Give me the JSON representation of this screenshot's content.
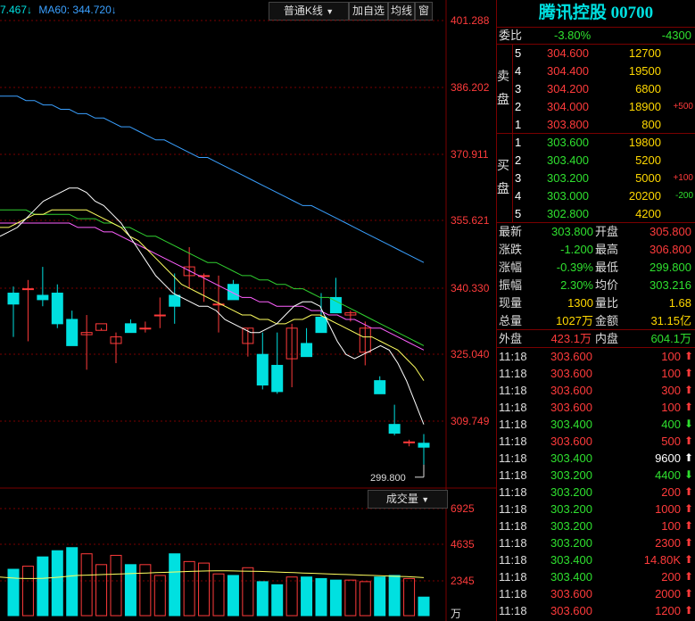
{
  "ma_header": {
    "ma_prev": "7.467↓",
    "ma60": "MA60: 344.720↓"
  },
  "toolbar": {
    "kline_type": "普通K线",
    "add_watch": "加自选",
    "avg_line": "均线",
    "window": "窗"
  },
  "price_axis": {
    "labels": [
      "401.288",
      "386.202",
      "370.911",
      "355.621",
      "340.330",
      "325.040",
      "309.749"
    ],
    "low_label": "299.800"
  },
  "volume_panel": {
    "dropdown": "成交量",
    "labels": [
      "6925",
      "4635",
      "2345"
    ],
    "unit": "万"
  },
  "colors": {
    "up": "#ff3b3b",
    "down": "#00e0e0",
    "grid": "#7a0000",
    "ma5": "#ffffff",
    "ma10": "#ffff60",
    "ma20": "#ff60ff",
    "ma30": "#30d030",
    "ma60": "#3aa0ff"
  },
  "chart_data": {
    "type": "candlestick",
    "ylim": [
      299.8,
      401.288
    ],
    "candles": [
      {
        "o": 352.5,
        "h": 364.0,
        "l": 343.5,
        "c": 352.0
      },
      {
        "o": 357.0,
        "h": 360.0,
        "l": 340.0,
        "c": 359.0
      },
      {
        "o": 358.5,
        "h": 360.5,
        "l": 357.0,
        "c": 359.0
      },
      {
        "o": 357.0,
        "h": 361.0,
        "l": 350.5,
        "c": 360.0
      },
      {
        "o": 359.0,
        "h": 365.0,
        "l": 355.5,
        "c": 364.0
      },
      {
        "o": 363.0,
        "h": 364.0,
        "l": 361.5,
        "c": 362.0
      },
      {
        "o": 363.5,
        "h": 368.0,
        "l": 360.0,
        "c": 363.0
      },
      {
        "o": 366.0,
        "h": 368.0,
        "l": 358.0,
        "c": 366.0
      },
      {
        "o": 365.0,
        "h": 368.0,
        "l": 361.0,
        "c": 364.5
      },
      {
        "o": 361.0,
        "h": 364.0,
        "l": 356.0,
        "c": 362.0
      },
      {
        "o": 355.5,
        "h": 360.0,
        "l": 354.5,
        "c": 355.5
      },
      {
        "o": 357.0,
        "h": 360.5,
        "l": 354.5,
        "c": 354.5
      },
      {
        "o": 363.5,
        "h": 366.0,
        "l": 360.5,
        "c": 360.0
      },
      {
        "o": 360.0,
        "h": 361.5,
        "l": 358.0,
        "c": 356.0
      },
      {
        "o": 357.0,
        "h": 360.0,
        "l": 350.0,
        "c": 352.0
      },
      {
        "o": 350.5,
        "h": 351.0,
        "l": 348.0,
        "c": 341.0
      },
      {
        "o": 346.5,
        "h": 352.0,
        "l": 340.0,
        "c": 348.0
      },
      {
        "o": 337.5,
        "h": 344.0,
        "l": 335.0,
        "c": 340.0
      },
      {
        "o": 341.0,
        "h": 347.0,
        "l": 333.0,
        "c": 338.0
      },
      {
        "o": 345.0,
        "h": 350.0,
        "l": 332.0,
        "c": 345.0
      },
      {
        "o": 335.0,
        "h": 337.0,
        "l": 331.0,
        "c": 336.0
      },
      {
        "o": 339.0,
        "h": 340.5,
        "l": 329.0,
        "c": 336.5
      },
      {
        "o": 340.0,
        "h": 342.0,
        "l": 328.0,
        "c": 340.0
      },
      {
        "o": 338.5,
        "h": 345.0,
        "l": 336.0,
        "c": 337.5
      },
      {
        "o": 339.0,
        "h": 341.0,
        "l": 331.0,
        "c": 332.0
      },
      {
        "o": 333.0,
        "h": 335.0,
        "l": 331.0,
        "c": 327.0
      },
      {
        "o": 329.5,
        "h": 334.0,
        "l": 321.5,
        "c": 330.0
      },
      {
        "o": 330.5,
        "h": 331.0,
        "l": 330.5,
        "c": 332.0
      },
      {
        "o": 327.5,
        "h": 330.0,
        "l": 323.0,
        "c": 329.0
      },
      {
        "o": 332.0,
        "h": 333.0,
        "l": 330.0,
        "c": 330.0
      },
      {
        "o": 331.0,
        "h": 332.5,
        "l": 330.0,
        "c": 331.0
      },
      {
        "o": 334.0,
        "h": 338.0,
        "l": 331.0,
        "c": 334.0
      },
      {
        "o": 338.5,
        "h": 343.5,
        "l": 332.0,
        "c": 336.0
      },
      {
        "o": 343.0,
        "h": 349.5,
        "l": 340.0,
        "c": 345.0
      },
      {
        "o": 343.0,
        "h": 343.5,
        "l": 337.0,
        "c": 343.0
      },
      {
        "o": 336.5,
        "h": 343.0,
        "l": 330.0,
        "c": 336.5
      },
      {
        "o": 341.0,
        "h": 342.0,
        "l": 338.5,
        "c": 337.5
      },
      {
        "o": 327.5,
        "h": 331.0,
        "l": 324.5,
        "c": 331.0
      },
      {
        "o": 325.0,
        "h": 330.0,
        "l": 317.0,
        "c": 318.0
      },
      {
        "o": 322.5,
        "h": 330.0,
        "l": 316.0,
        "c": 316.5
      },
      {
        "o": 324.0,
        "h": 332.0,
        "l": 317.5,
        "c": 331.0
      },
      {
        "o": 327.5,
        "h": 331.0,
        "l": 325.0,
        "c": 324.5
      },
      {
        "o": 333.5,
        "h": 339.0,
        "l": 330.5,
        "c": 330.0
      },
      {
        "o": 338.0,
        "h": 342.5,
        "l": 336.5,
        "c": 334.5
      },
      {
        "o": 334.0,
        "h": 335.0,
        "l": 332.5,
        "c": 334.5
      },
      {
        "o": 325.5,
        "h": 332.5,
        "l": 322.5,
        "c": 331.0
      },
      {
        "o": 319.0,
        "h": 320.0,
        "l": 317.0,
        "c": 316.0
      },
      {
        "o": 309.0,
        "h": 313.5,
        "l": 306.5,
        "c": 307.0
      },
      {
        "o": 305.0,
        "h": 305.5,
        "l": 304.0,
        "c": 305.0
      },
      {
        "o": 304.7,
        "h": 306.8,
        "l": 299.8,
        "c": 303.8
      }
    ],
    "ma5": [
      352,
      353,
      354,
      356,
      358,
      360,
      361,
      362,
      363,
      363,
      362,
      360,
      359,
      357,
      355,
      352,
      349,
      346,
      343,
      341,
      339,
      338,
      337,
      336,
      336,
      335,
      333,
      332,
      331,
      330,
      330,
      331,
      332,
      334,
      336,
      337,
      337,
      336,
      332,
      328,
      325,
      324,
      325,
      326,
      327,
      326,
      323,
      319,
      314,
      309
    ],
    "ma10": [
      354,
      354,
      355,
      356,
      357,
      357,
      358,
      358,
      358,
      358,
      358,
      357,
      356,
      355,
      354,
      352,
      351,
      349,
      347,
      345,
      343,
      341,
      340,
      339,
      338,
      337,
      336,
      335,
      334,
      334,
      333,
      333,
      332,
      332,
      333,
      333,
      334,
      334,
      333,
      332,
      331,
      330,
      329,
      329,
      328,
      327,
      326,
      324,
      322,
      319
    ],
    "ma20": [
      355,
      355,
      355,
      355,
      355,
      355,
      355,
      355,
      355,
      354,
      354,
      354,
      353,
      353,
      352,
      351,
      350,
      349,
      348,
      347,
      346,
      345,
      344,
      343,
      342,
      341,
      340,
      339,
      338,
      338,
      337,
      337,
      336,
      336,
      336,
      336,
      335,
      335,
      334,
      334,
      333,
      333,
      332,
      331,
      331,
      330,
      329,
      328,
      327,
      326
    ],
    "ma30": [
      358,
      358,
      358,
      358,
      357,
      357,
      357,
      357,
      357,
      356,
      356,
      356,
      355,
      355,
      354,
      354,
      353,
      352,
      352,
      351,
      350,
      349,
      348,
      347,
      346,
      346,
      345,
      344,
      343,
      343,
      342,
      342,
      341,
      341,
      340,
      340,
      339,
      338,
      338,
      337,
      336,
      335,
      334,
      333,
      332,
      331,
      330,
      329,
      328,
      327
    ],
    "ma60": [
      384,
      384,
      384,
      383,
      383,
      382,
      382,
      381,
      381,
      380,
      380,
      379,
      379,
      378,
      377,
      377,
      376,
      375,
      374,
      374,
      373,
      372,
      371,
      370,
      370,
      369,
      368,
      367,
      366,
      365,
      364,
      363,
      362,
      361,
      360,
      359,
      359,
      358,
      357,
      356,
      355,
      354,
      353,
      352,
      351,
      350,
      349,
      348,
      347,
      346
    ],
    "volume_ylim": [
      0,
      6925
    ],
    "volumes": [
      2400,
      2200,
      2100,
      2400,
      2600,
      2700,
      2800,
      3000,
      3100,
      5000,
      2100,
      2000,
      2200,
      2400,
      2500,
      2600,
      2800,
      3200,
      2700,
      2900,
      3300,
      3000,
      3200,
      3800,
      4200,
      4400,
      4000,
      3300,
      3900,
      3300,
      3300,
      2600,
      4000,
      3500,
      3400,
      2700,
      2600,
      3100,
      2200,
      2000,
      2500,
      2500,
      2400,
      2300,
      2300,
      2200,
      2500,
      2600,
      2400,
      1200
    ],
    "volume_ma": [
      2500,
      2450,
      2420,
      2400,
      2400,
      2420,
      2450,
      2500,
      2550,
      2600,
      2620,
      2640,
      2660,
      2680,
      2700,
      2720,
      2740,
      2760,
      2780,
      2800,
      2820,
      2840,
      2860,
      2880,
      2890,
      2900,
      2900,
      2890,
      2880,
      2870,
      2860,
      2840,
      2820,
      2800,
      2780,
      2760,
      2740,
      2720,
      2700,
      2680,
      2660,
      2640,
      2620,
      2600,
      2580,
      2560,
      2540,
      2520,
      2500,
      2460
    ]
  },
  "quote_panel": {
    "title": "腾讯控股 00700",
    "weibi": {
      "label": "委比",
      "pct": "-3.80%",
      "diff": "-4300"
    },
    "ask_label": [
      "卖",
      "盘"
    ],
    "bid_label": [
      "买",
      "盘"
    ],
    "asks": [
      {
        "level": "5",
        "price": "304.600",
        "vol": "12700",
        "chg": ""
      },
      {
        "level": "4",
        "price": "304.400",
        "vol": "19500",
        "chg": ""
      },
      {
        "level": "3",
        "price": "304.200",
        "vol": "6800",
        "chg": ""
      },
      {
        "level": "2",
        "price": "304.000",
        "vol": "18900",
        "chg": "+500"
      },
      {
        "level": "1",
        "price": "303.800",
        "vol": "800",
        "chg": ""
      }
    ],
    "bids": [
      {
        "level": "1",
        "price": "303.600",
        "vol": "19800",
        "chg": ""
      },
      {
        "level": "2",
        "price": "303.400",
        "vol": "5200",
        "chg": ""
      },
      {
        "level": "3",
        "price": "303.200",
        "vol": "5000",
        "chg": "+100"
      },
      {
        "level": "4",
        "price": "303.000",
        "vol": "20200",
        "chg": "-200"
      },
      {
        "level": "5",
        "price": "302.800",
        "vol": "4200",
        "chg": ""
      }
    ],
    "stats": [
      {
        "l1": "最新",
        "v1": "303.800",
        "c1": "green",
        "l2": "开盘",
        "v2": "305.800",
        "c2": "red"
      },
      {
        "l1": "涨跌",
        "v1": "-1.200",
        "c1": "green",
        "l2": "最高",
        "v2": "306.800",
        "c2": "red"
      },
      {
        "l1": "涨幅",
        "v1": "-0.39%",
        "c1": "green",
        "l2": "最低",
        "v2": "299.800",
        "c2": "green"
      },
      {
        "l1": "振幅",
        "v1": "2.30%",
        "c1": "green",
        "l2": "均价",
        "v2": "303.216",
        "c2": "green"
      },
      {
        "l1": "现量",
        "v1": "1300",
        "c1": "yellow",
        "l2": "量比",
        "v2": "1.68",
        "c2": "yellow"
      },
      {
        "l1": "总量",
        "v1": "1027万",
        "c1": "yellow",
        "l2": "金额",
        "v2": "31.15亿",
        "c2": "yellow"
      }
    ],
    "outer_inner": {
      "l1": "外盘",
      "v1": "423.1万",
      "l2": "内盘",
      "v2": "604.1万"
    },
    "ticks": [
      {
        "t": "11:18",
        "p": "303.600",
        "v": "100",
        "d": "up"
      },
      {
        "t": "11:18",
        "p": "303.600",
        "v": "100",
        "d": "up"
      },
      {
        "t": "11:18",
        "p": "303.600",
        "v": "300",
        "d": "up"
      },
      {
        "t": "11:18",
        "p": "303.600",
        "v": "100",
        "d": "up"
      },
      {
        "t": "11:18",
        "p": "303.400",
        "v": "400",
        "d": "down"
      },
      {
        "t": "11:18",
        "p": "303.600",
        "v": "500",
        "d": "up"
      },
      {
        "t": "11:18",
        "p": "303.400",
        "v": "9600",
        "d": "neutral"
      },
      {
        "t": "11:18",
        "p": "303.200",
        "v": "4400",
        "d": "down"
      },
      {
        "t": "11:18",
        "p": "303.200",
        "v": "200",
        "d": "up"
      },
      {
        "t": "11:18",
        "p": "303.200",
        "v": "1000",
        "d": "up"
      },
      {
        "t": "11:18",
        "p": "303.200",
        "v": "100",
        "d": "up"
      },
      {
        "t": "11:18",
        "p": "303.200",
        "v": "2300",
        "d": "up"
      },
      {
        "t": "11:18",
        "p": "303.400",
        "v": "14.80K",
        "d": "up"
      },
      {
        "t": "11:18",
        "p": "303.400",
        "v": "200",
        "d": "up"
      },
      {
        "t": "11:18",
        "p": "303.600",
        "v": "2000",
        "d": "up"
      },
      {
        "t": "11:18",
        "p": "303.600",
        "v": "1200",
        "d": "up"
      }
    ]
  }
}
